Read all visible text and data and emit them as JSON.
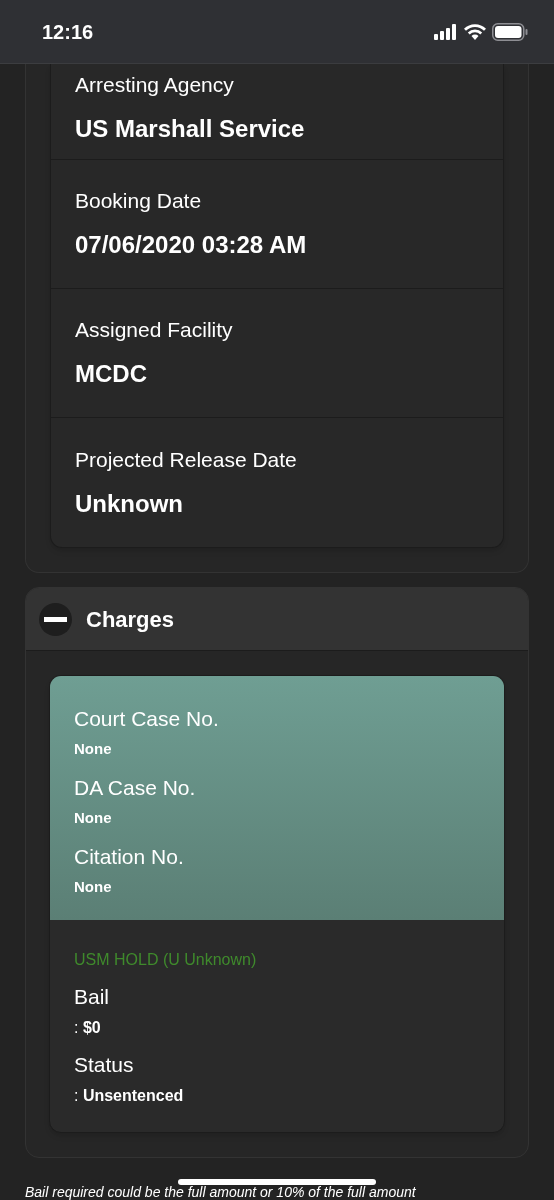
{
  "status_bar": {
    "time": "12:16"
  },
  "details": [
    {
      "label": "Arresting Agency",
      "value": "US Marshall Service"
    },
    {
      "label": "Booking Date",
      "value": "07/06/2020 03:28 AM"
    },
    {
      "label": "Assigned Facility",
      "value": "MCDC"
    },
    {
      "label": "Projected Release Date",
      "value": "Unknown"
    }
  ],
  "charges": {
    "title": "Charges",
    "expanded": true,
    "case_numbers": [
      {
        "label": "Court Case No.",
        "value": "None"
      },
      {
        "label": "DA Case No.",
        "value": "None"
      },
      {
        "label": "Citation No.",
        "value": "None"
      }
    ],
    "charge": {
      "name": "USM HOLD (U Unknown)",
      "color": "#3f8a2c",
      "fields": [
        {
          "label": "Bail",
          "value": ": **$0**"
        },
        {
          "label": "Status",
          "value": ": **Unsentenced**"
        }
      ]
    }
  },
  "footnote": "Bail required could be the full amount or 10% of the full amount"
}
